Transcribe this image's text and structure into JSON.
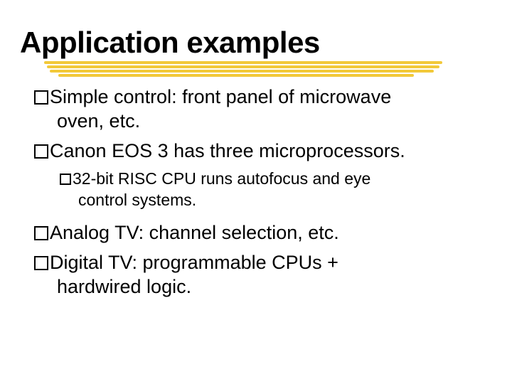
{
  "title": "Application examples",
  "bullets": [
    {
      "level": 1,
      "text": "Simple control: front panel of microwave",
      "cont": "oven, etc."
    },
    {
      "level": 1,
      "text": "Canon EOS 3 has three microprocessors."
    },
    {
      "level": 2,
      "text": "32-bit RISC CPU runs autofocus and eye",
      "cont": "control systems."
    },
    {
      "level": 1,
      "text": "Analog TV: channel selection, etc."
    },
    {
      "level": 1,
      "text": "Digital TV: programmable CPUs +",
      "cont": "hardwired logic."
    }
  ]
}
